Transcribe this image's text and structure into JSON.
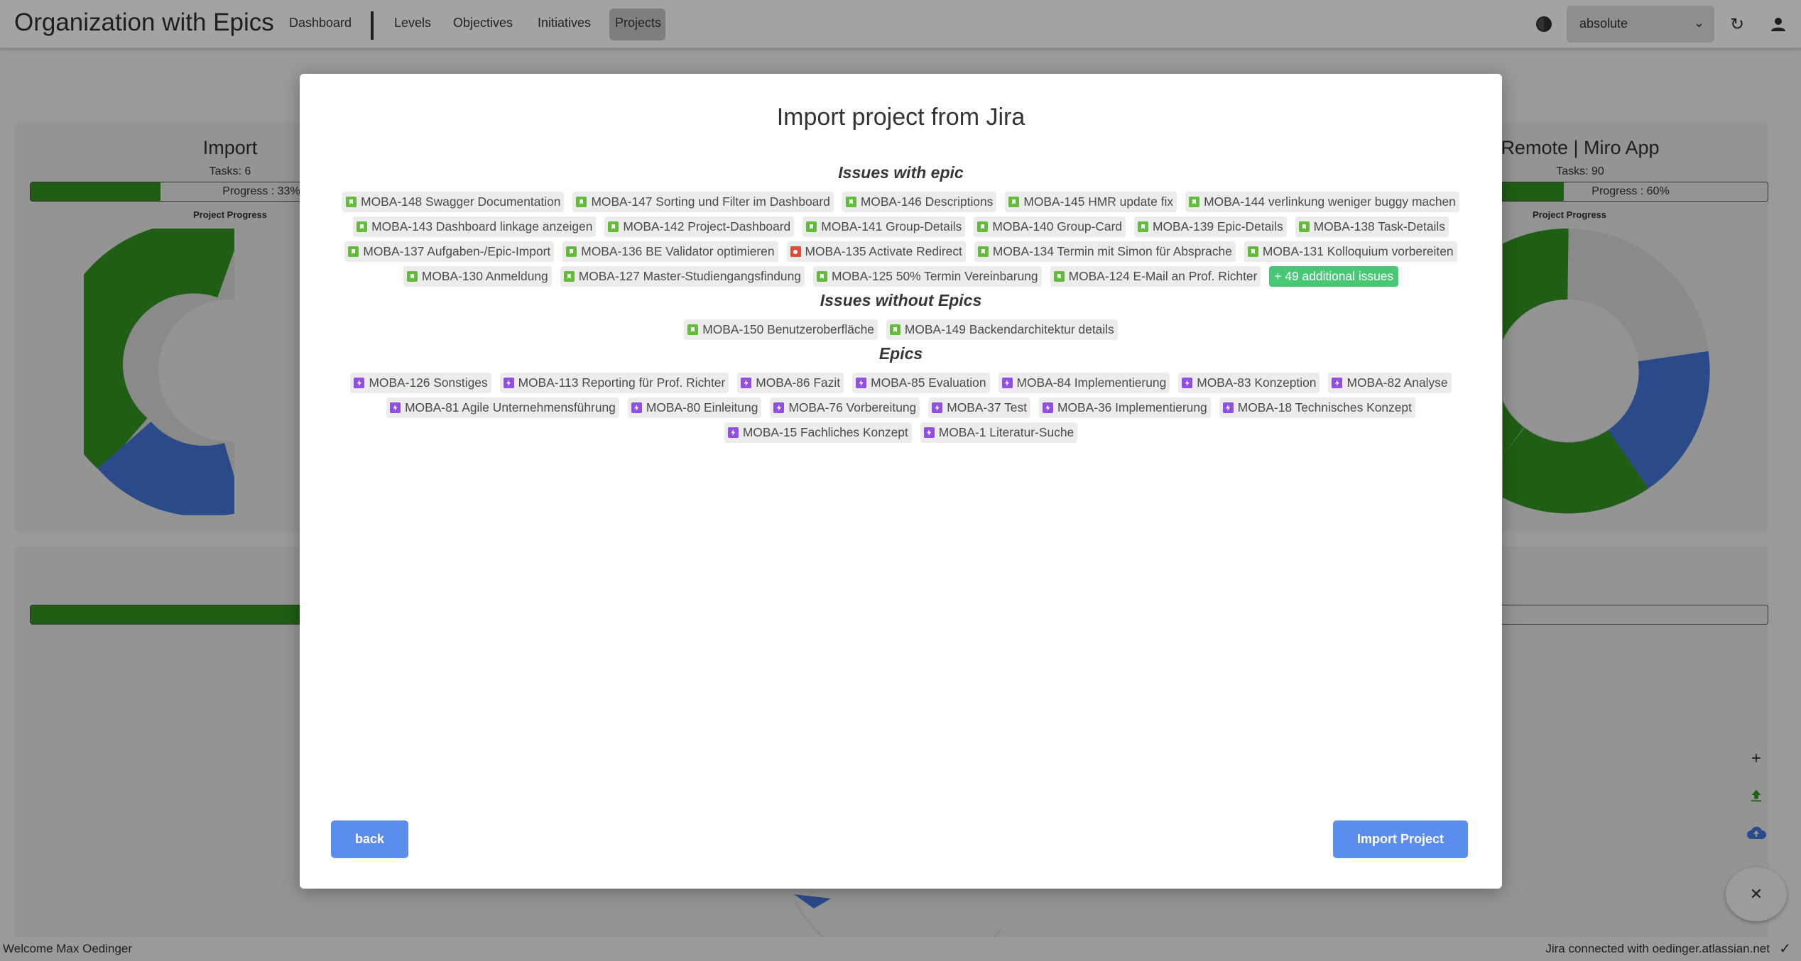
{
  "app": {
    "title": "Organization with Epics"
  },
  "nav": {
    "dashboard": "Dashboard",
    "levels": "Levels",
    "objectives": "Objectives",
    "initiatives": "Initiatives",
    "projects": "Projects"
  },
  "topbar": {
    "theme_icon": "half-circle-icon",
    "select_value": "absolute",
    "refresh_icon": "refresh-icon",
    "user_icon": "user-icon"
  },
  "cards": {
    "left": {
      "title": "Import",
      "tasks": "Tasks: 6",
      "progress_label": "Progress : 33%",
      "progress": 0.33,
      "caption": "Project Progress"
    },
    "right": {
      "title": "Remote | Miro App",
      "tasks": "Tasks: 90",
      "progress_label": "Progress : 60%",
      "progress": 0.6,
      "caption": "Project Progress"
    }
  },
  "footer": {
    "welcome": "Welcome Max Oedinger",
    "jira_status": "Jira connected with oedinger.atlassian.net"
  },
  "fab": {
    "add_icon": "plus-icon",
    "upload_icon": "upload-icon",
    "cloud_icon": "cloud-upload-icon",
    "close_icon": "close-icon"
  },
  "colors": {
    "primary_button": "#5b8def",
    "story": "#63ba3c",
    "bug": "#e5493a",
    "epic": "#904ee2",
    "more_badge": "#48c774"
  },
  "modal": {
    "title": "Import project from Jira",
    "issues_with_epic_heading": "Issues with epic",
    "issues_with_epic_rows": [
      [
        {
          "type": "story",
          "label": "MOBA-148 Swagger Documentation"
        },
        {
          "type": "story",
          "label": "MOBA-147 Sorting und Filter im Dashboard"
        },
        {
          "type": "story",
          "label": "MOBA-146 Descriptions"
        },
        {
          "type": "story",
          "label": "MOBA-145 HMR update fix"
        },
        {
          "type": "story",
          "label": "MOBA-144 verlinkung weniger buggy machen"
        }
      ],
      [
        {
          "type": "story",
          "label": "MOBA-143 Dashboard linkage anzeigen"
        },
        {
          "type": "story",
          "label": "MOBA-142 Project-Dashboard"
        },
        {
          "type": "story",
          "label": "MOBA-141 Group-Details"
        },
        {
          "type": "story",
          "label": "MOBA-140 Group-Card"
        },
        {
          "type": "story",
          "label": "MOBA-139 Epic-Details"
        },
        {
          "type": "story",
          "label": "MOBA-138 Task-Details"
        }
      ],
      [
        {
          "type": "story",
          "label": "MOBA-137 Aufgaben-/Epic-Import"
        },
        {
          "type": "story",
          "label": "MOBA-136 BE Validator optimieren"
        },
        {
          "type": "bug",
          "label": "MOBA-135 Activate Redirect"
        },
        {
          "type": "story",
          "label": "MOBA-134 Termin mit Simon für Absprache"
        },
        {
          "type": "story",
          "label": "MOBA-131 Kolloquium vorbereiten"
        }
      ],
      [
        {
          "type": "story",
          "label": "MOBA-130 Anmeldung"
        },
        {
          "type": "story",
          "label": "MOBA-127 Master-Studiengangsfindung"
        },
        {
          "type": "story",
          "label": "MOBA-125 50% Termin Vereinbarung"
        },
        {
          "type": "story",
          "label": "MOBA-124 E-Mail an Prof. Richter"
        }
      ]
    ],
    "more_issues": "+ 49 additional issues",
    "issues_without_epics_heading": "Issues without Epics",
    "issues_without_epics": [
      {
        "type": "story",
        "label": "MOBA-150 Benutzeroberfläche"
      },
      {
        "type": "story",
        "label": "MOBA-149 Backendarchitektur details"
      }
    ],
    "epics_heading": "Epics",
    "epics_rows": [
      [
        {
          "type": "epic",
          "label": "MOBA-126 Sonstiges"
        },
        {
          "type": "epic",
          "label": "MOBA-113 Reporting für Prof. Richter"
        },
        {
          "type": "epic",
          "label": "MOBA-86 Fazit"
        },
        {
          "type": "epic",
          "label": "MOBA-85 Evaluation"
        },
        {
          "type": "epic",
          "label": "MOBA-84 Implementierung"
        },
        {
          "type": "epic",
          "label": "MOBA-83 Konzeption"
        },
        {
          "type": "epic",
          "label": "MOBA-82 Analyse"
        }
      ],
      [
        {
          "type": "epic",
          "label": "MOBA-81 Agile Unternehmensführung"
        },
        {
          "type": "epic",
          "label": "MOBA-80 Einleitung"
        },
        {
          "type": "epic",
          "label": "MOBA-76 Vorbereitung"
        },
        {
          "type": "epic",
          "label": "MOBA-37 Test"
        },
        {
          "type": "epic",
          "label": "MOBA-36 Implementierung"
        },
        {
          "type": "epic",
          "label": "MOBA-18 Technisches Konzept"
        }
      ],
      [
        {
          "type": "epic",
          "label": "MOBA-15 Fachliches Konzept"
        },
        {
          "type": "epic",
          "label": "MOBA-1 Literatur-Suche"
        }
      ]
    ],
    "back_button": "back",
    "import_button": "Import Project"
  }
}
